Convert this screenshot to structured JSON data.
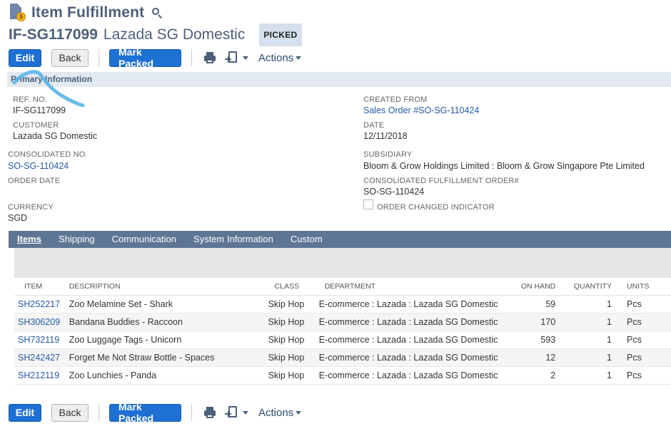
{
  "header": {
    "title": "Item Fulfillment",
    "record_id": "IF-SG117099",
    "record_name": "Lazada SG Domestic",
    "status": "PICKED"
  },
  "toolbar": {
    "edit_label": "Edit",
    "back_label": "Back",
    "mark_packed_label": "Mark Packed",
    "actions_label": "Actions"
  },
  "section": {
    "title": "Primary Information"
  },
  "fields": {
    "ref_no_label": "REF. NO.",
    "ref_no_value": "IF-SG117099",
    "customer_label": "CUSTOMER",
    "customer_value": "Lazada SG Domestic",
    "consolidated_no_label": "CONSOLIDATED NO.",
    "consolidated_no_value": "SO-SG-110424",
    "order_date_label": "ORDER DATE",
    "currency_label": "CURRENCY",
    "currency_value": "SGD",
    "created_from_label": "CREATED FROM",
    "created_from_value": "Sales Order #SO-SG-110424",
    "date_label": "DATE",
    "date_value": "12/11/2018",
    "subsidiary_label": "SUBSIDIARY",
    "subsidiary_value": "Bloom & Grow Holdings Limited : Bloom & Grow Singapore Pte Limited",
    "consolidated_fulfillment_label": "CONSOLIDATED FULFILLMENT ORDER#",
    "consolidated_fulfillment_value": "SO-SG-110424",
    "order_changed_label": "ORDER CHANGED INDICATOR"
  },
  "tabs": [
    {
      "label": "Items"
    },
    {
      "label": "Shipping"
    },
    {
      "label": "Communication"
    },
    {
      "label": "System Information"
    },
    {
      "label": "Custom"
    }
  ],
  "table": {
    "columns": [
      "ITEM",
      "DESCRIPTION",
      "CLASS",
      "DEPARTMENT",
      "ON HAND",
      "QUANTITY",
      "UNITS"
    ],
    "rows": [
      {
        "item": "SH252217",
        "description": "Zoo Melamine Set - Shark",
        "class": "Skip Hop",
        "department": "E-commerce : Lazada : Lazada SG Domestic",
        "on_hand": "59",
        "quantity": "1",
        "units": "Pcs"
      },
      {
        "item": "SH306209",
        "description": "Bandana Buddies - Raccoon",
        "class": "Skip Hop",
        "department": "E-commerce : Lazada : Lazada SG Domestic",
        "on_hand": "170",
        "quantity": "1",
        "units": "Pcs"
      },
      {
        "item": "SH732119",
        "description": "Zoo Luggage Tags - Unicorn",
        "class": "Skip Hop",
        "department": "E-commerce : Lazada : Lazada SG Domestic",
        "on_hand": "593",
        "quantity": "1",
        "units": "Pcs"
      },
      {
        "item": "SH242427",
        "description": "Forget Me Not Straw Bottle - Spaces",
        "class": "Skip Hop",
        "department": "E-commerce : Lazada : Lazada SG Domestic",
        "on_hand": "12",
        "quantity": "1",
        "units": "Pcs"
      },
      {
        "item": "SH212119",
        "description": "Zoo Lunchies - Panda",
        "class": "Skip Hop",
        "department": "E-commerce : Lazada : Lazada SG Domestic",
        "on_hand": "2",
        "quantity": "1",
        "units": "Pcs"
      }
    ]
  },
  "icons": {
    "page": "item-fulfillment-icon",
    "search": "search-icon",
    "print": "print-icon",
    "new_record": "new-record-icon",
    "annotation": "blue-pen-stroke"
  },
  "colors": {
    "primary_button": "#1e70d3",
    "title_text": "#4d5f79",
    "tab_bar": "#5f7594",
    "link": "#255aa3",
    "annotation_stroke": "#5ab4e8"
  }
}
